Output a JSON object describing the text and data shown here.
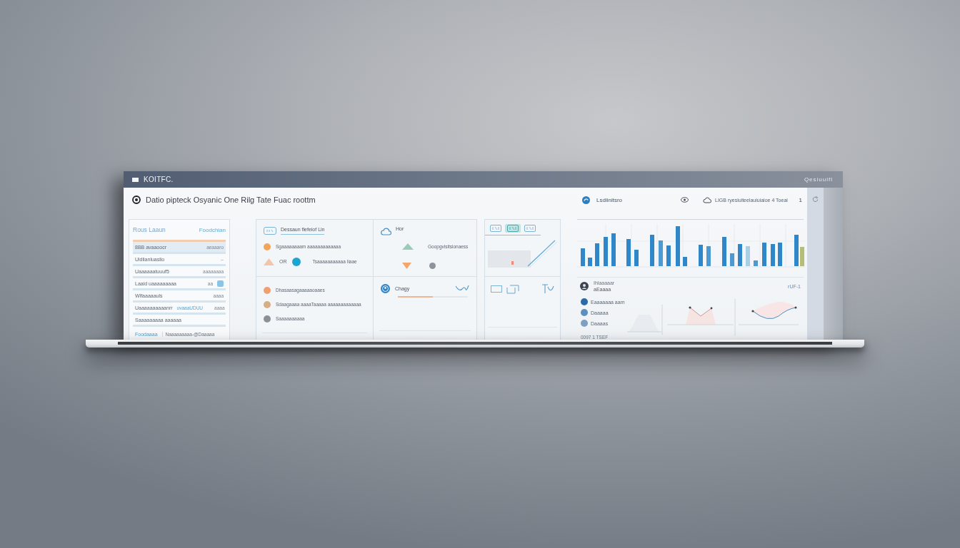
{
  "window": {
    "title": "KOITFC.",
    "caption": "Qesiuuifl"
  },
  "header": {
    "title": "Datio pipteck Osyanic One Rilg Tate Fuac roottm",
    "section": "Lsdiinitsro",
    "status": "LIGB  ryesiuiteelauiuiaioe 4 Toeai",
    "count": "1"
  },
  "sidebar": {
    "title": "Rous Laaun",
    "action": "Foodchian",
    "rows": [
      {
        "kind": "text",
        "label": "8BB avaaoocr",
        "value": "aeaaaro",
        "selected": true
      },
      {
        "kind": "text",
        "label": "Uidlianluaslio",
        "value": "--",
        "selected": false
      },
      {
        "kind": "text",
        "label": "Uaaaaaatuuuf5",
        "value": "aaaaaaaa",
        "selected": false
      },
      {
        "kind": "icon",
        "label": "Laaid uaaaaaaaaa",
        "value": "aa",
        "selected": false
      },
      {
        "kind": "text",
        "label": "Wlfaaaaauls",
        "value": "aaaa",
        "selected": false
      },
      {
        "kind": "tag",
        "label": "Uaaaaaaaaaanrr",
        "tag": "uvaaaUDUU",
        "value": "aaaa",
        "selected": false
      },
      {
        "kind": "text",
        "label": "Saaaaaaaaa aaaaaa",
        "selected": false
      }
    ],
    "footer": {
      "link": "Foodaaaa",
      "text": "Naaaaaaaaa-@Daaaaa"
    }
  },
  "middle": {
    "tab": "Dessaun flefeiof Lin",
    "summary": [
      {
        "kind": "dot",
        "color": "#f0a45c",
        "text": "Sgaaaaaaaam aaaaaaaaaaaaa"
      },
      {
        "kind": "pair",
        "code": "OR",
        "color": "#1ea4d0",
        "text": "Tsaaaaaaaaaaa  Iiaae"
      }
    ],
    "trend": {
      "label": "Hor",
      "rows": [
        {
          "kind": "up",
          "text": "Goopgvisitsionaess"
        },
        {
          "kind": "down"
        }
      ]
    },
    "list": [
      {
        "color": "#f0a070",
        "text": "Dhasaasagaaaaaoaaes"
      },
      {
        "color": "#d6ae86",
        "text": "Sdaagaaaa aaaaTaaaaa aaaaaaaaaaaaa"
      },
      {
        "color": "#8d9197",
        "text": "Saaaaaaaaaa"
      }
    ],
    "progress": {
      "label": "Chagy",
      "level": 0.5
    }
  },
  "third": {
    "tabs": [
      {
        "selected": false
      },
      {
        "selected": true
      },
      {
        "selected": false
      }
    ]
  },
  "right": {
    "detail": {
      "title": "Ihlaaaaar",
      "subtitle": "aEaaaa",
      "code": "rUF-1"
    },
    "legend": [
      {
        "color": "#2a6aa6",
        "label": "Eaaaaaaa aam"
      },
      {
        "color": "#5b8fc1",
        "label": "Daaaaa"
      },
      {
        "color": "#7c9fc2",
        "label": "Daaaas"
      }
    ],
    "footer": "0097 1 TSEF"
  }
}
